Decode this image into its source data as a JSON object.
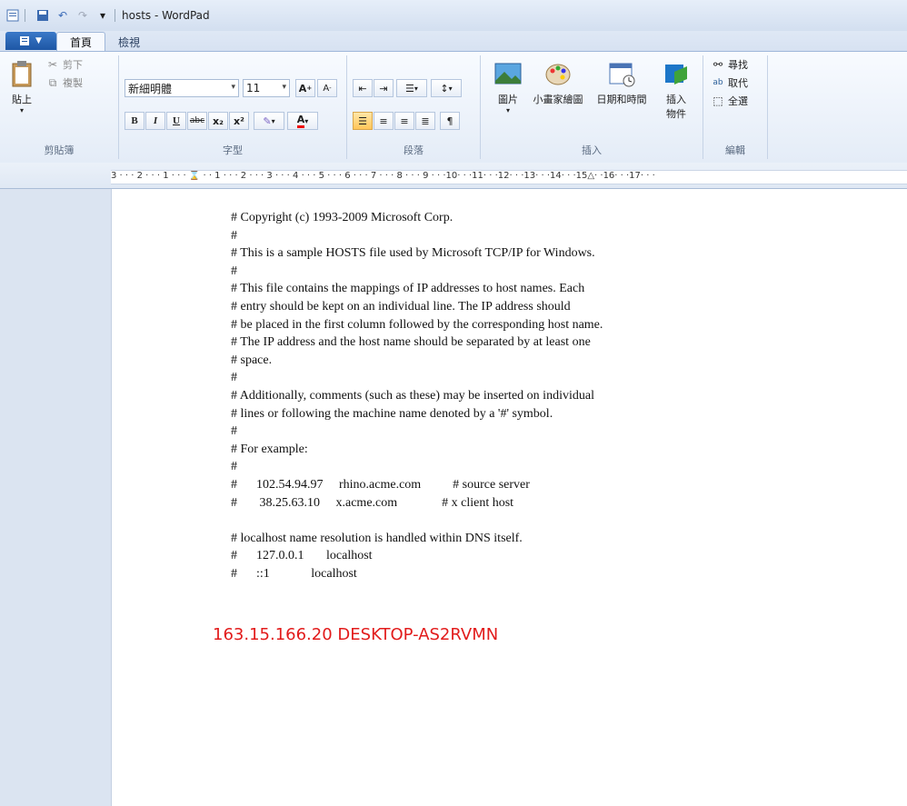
{
  "window": {
    "title": "hosts - WordPad"
  },
  "tabs": [
    {
      "label": "首頁"
    },
    {
      "label": "檢視"
    }
  ],
  "clipboard": {
    "paste_label": "貼上",
    "cut_label": "剪下",
    "copy_label": "複製",
    "group_label": "剪貼簿"
  },
  "font": {
    "family": "新細明體",
    "size": "11",
    "group_label": "字型",
    "bold": "B",
    "italic": "I",
    "underline": "U",
    "strike": "abc",
    "sub": "x₂",
    "sup": "x²",
    "color_letter": "A",
    "grow": "A",
    "shrink": "A"
  },
  "paragraph": {
    "group_label": "段落"
  },
  "insert": {
    "picture": "圖片",
    "paint": "小畫家繪圖",
    "datetime": "日期和時間",
    "object": "插入\n物件",
    "group_label": "插入"
  },
  "edit": {
    "find": "尋找",
    "replace": "取代",
    "select_all": "全選",
    "group_label": "編輯"
  },
  "ruler": {
    "text": "3 · · · 2 · · · 1 · · · ⌛ · · 1 · · · 2 · · · 3 · · · 4 · · · 5 · · · 6 · · · 7 · · · 8 · · · 9 · · ·10· · ·11· · ·12· · ·13· · ·14· · ·15△· ·16· · ·17· · ·"
  },
  "document": {
    "lines": [
      "# Copyright (c) 1993-2009 Microsoft Corp.",
      "#",
      "# This is a sample HOSTS file used by Microsoft TCP/IP for Windows.",
      "#",
      "# This file contains the mappings of IP addresses to host names. Each",
      "# entry should be kept on an individual line. The IP address should",
      "# be placed in the first column followed by the corresponding host name.",
      "# The IP address and the host name should be separated by at least one",
      "# space.",
      "#",
      "# Additionally, comments (such as these) may be inserted on individual",
      "# lines or following the machine name denoted by a '#' symbol.",
      "#",
      "# For example:",
      "#",
      "#      102.54.94.97     rhino.acme.com          # source server",
      "#       38.25.63.10     x.acme.com              # x client host",
      "",
      "# localhost name resolution is handled within DNS itself.",
      "#\t127.0.0.1       localhost",
      "#\t::1             localhost"
    ],
    "host_entry": "163.15.166.20 DESKTOP-AS2RVMN",
    "host_entry_color": "#e21b1b"
  }
}
